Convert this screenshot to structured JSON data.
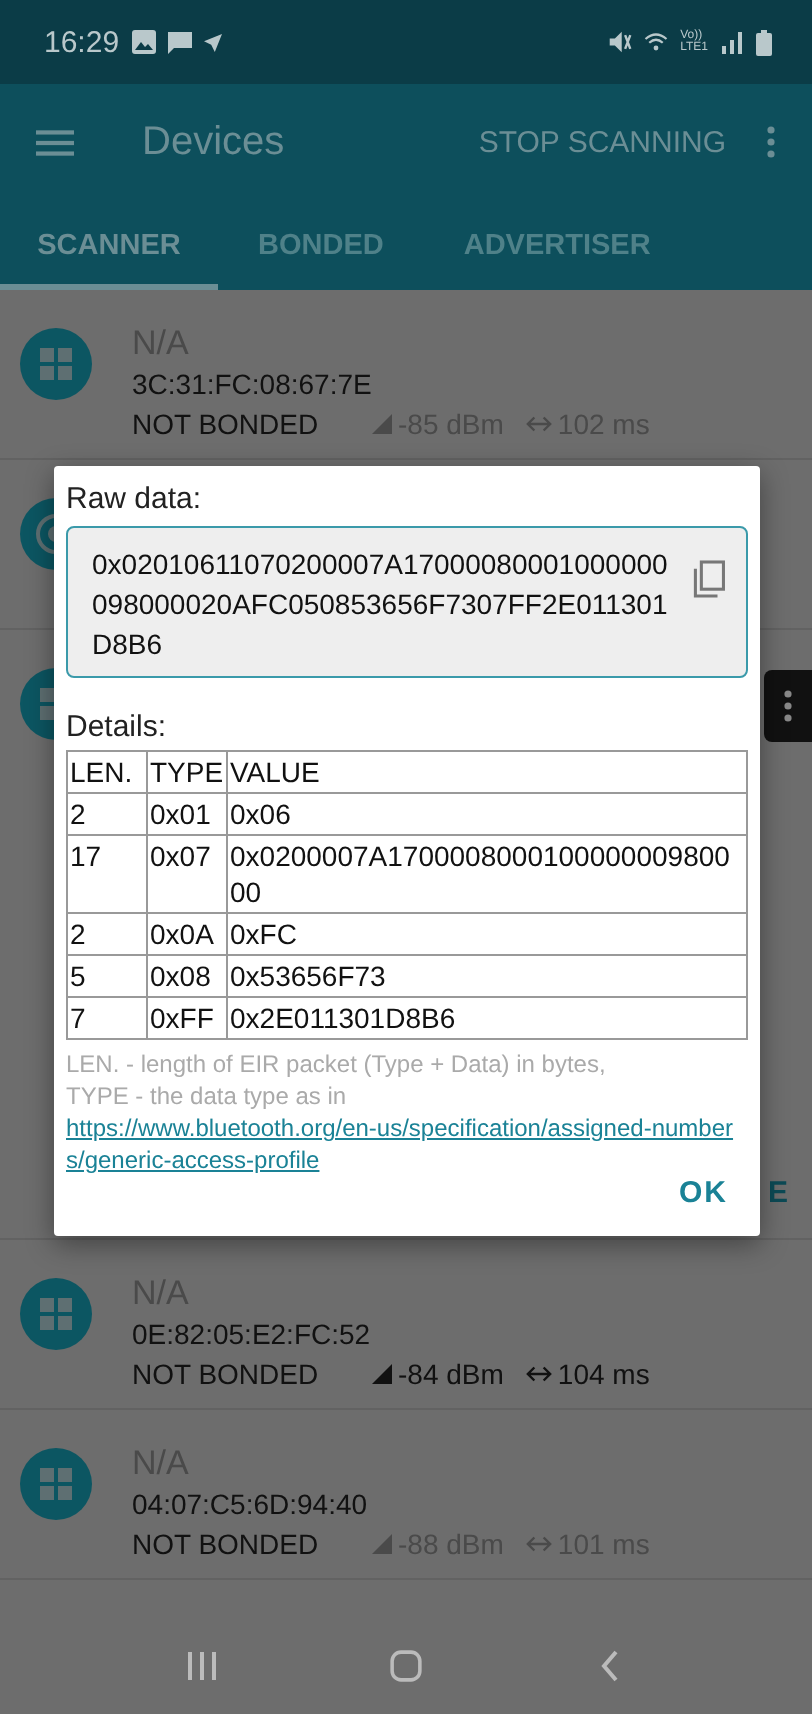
{
  "status_bar": {
    "time": "16:29",
    "network_label": [
      "Vo))",
      "LTE1"
    ]
  },
  "toolbar": {
    "title": "Devices",
    "action": "STOP SCANNING"
  },
  "tabs": [
    {
      "label": "SCANNER",
      "selected": true
    },
    {
      "label": "BONDED",
      "selected": false
    },
    {
      "label": "ADVERTISER",
      "selected": false
    }
  ],
  "devices": [
    {
      "kind": "device",
      "name": "N/A",
      "address": "3C:31:FC:08:67:7E",
      "bond": "NOT BONDED",
      "rssi": "-85 dBm",
      "interval": "102 ms",
      "stale": true
    },
    {
      "kind": "beacon"
    },
    {
      "kind": "covered",
      "menu": true,
      "action": "E"
    },
    {
      "kind": "device",
      "name": "N/A",
      "address": "0E:82:05:E2:FC:52",
      "bond": "NOT BONDED",
      "rssi": "-84 dBm",
      "interval": "104 ms",
      "stale": false
    },
    {
      "kind": "device",
      "name": "N/A",
      "address": "04:07:C5:6D:94:40",
      "bond": "NOT BONDED",
      "rssi": "-88 dBm",
      "interval": "101 ms",
      "stale": true
    },
    {
      "kind": "partial"
    }
  ],
  "dialog": {
    "raw_label": "Raw data:",
    "raw_value": "0x02010611070200007A17000080001000000098000020AFC050853656F7307FF2E011301D8B6",
    "details_label": "Details:",
    "table": {
      "columns": [
        "LEN.",
        "TYPE",
        "VALUE"
      ],
      "rows": [
        [
          "2",
          "0x01",
          "0x06"
        ],
        [
          "17",
          "0x07",
          "0x0200007A170000800010000000980000"
        ],
        [
          "2",
          "0x0A",
          "0xFC"
        ],
        [
          "5",
          "0x08",
          "0x53656F73"
        ],
        [
          "7",
          "0xFF",
          "0x2E011301D8B6"
        ]
      ]
    },
    "note": [
      "LEN. - length of EIR packet (Type + Data) in bytes,",
      "TYPE - the data type as in "
    ],
    "link": "https://www.bluetooth.org/en-us/specification/assigned-numbers/generic-access-profile",
    "ok": "OK"
  }
}
